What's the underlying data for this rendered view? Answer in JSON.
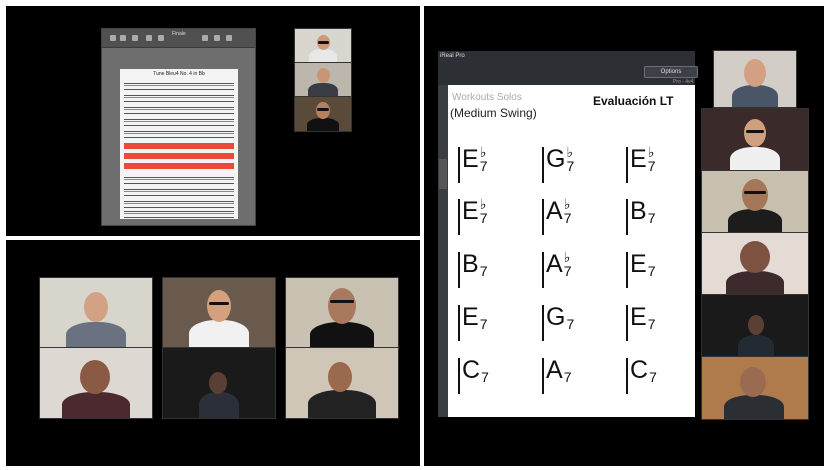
{
  "screen_share": {
    "app_title": "Finale",
    "score_title": "Tune Bleu4 No. 4 in Bb",
    "participants_count": 3
  },
  "gallery_participants": [
    "participant-1",
    "participant-2",
    "participant-3",
    "participant-4",
    "participant-5",
    "participant-6"
  ],
  "irealpro": {
    "app_name": "iReal Pro",
    "button_label": "Options",
    "sub_label": "Pro - 4v4",
    "section": "Workouts  Solos",
    "style": "(Medium Swing)",
    "title": "Evaluación LT",
    "chords": [
      [
        "E",
        "b",
        "7"
      ],
      [
        "G",
        "b",
        "7"
      ],
      [
        "E",
        "b",
        "7"
      ],
      [
        "E",
        "b",
        "7"
      ],
      [
        "A",
        "b",
        "7"
      ],
      [
        "B",
        "",
        "7"
      ],
      [
        "B",
        "",
        "7"
      ],
      [
        "A",
        "b",
        "7"
      ],
      [
        "E",
        "",
        "7"
      ],
      [
        "E",
        "",
        "7"
      ],
      [
        "G",
        "",
        "7"
      ],
      [
        "E",
        "",
        "7"
      ],
      [
        "C",
        "",
        "7"
      ],
      [
        "A",
        "",
        "7"
      ],
      [
        "C",
        "",
        "7"
      ]
    ]
  },
  "colors": {
    "pane_bg": "#000000",
    "divider": "#ffffff",
    "score_highlight": "#e94a3a"
  }
}
